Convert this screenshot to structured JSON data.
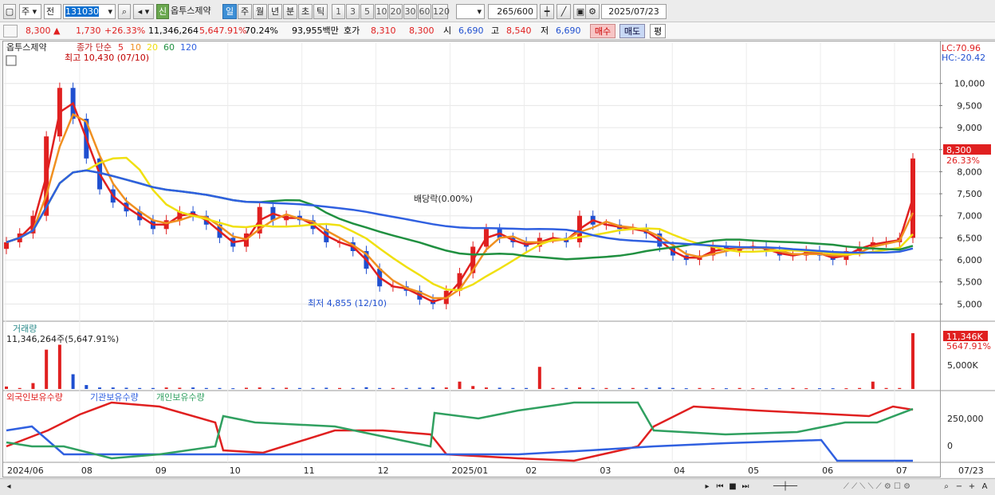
{
  "toolbar": {
    "type_label": "주",
    "prev_label": "전",
    "code_value": "131030",
    "new_badge": "신",
    "stock_name": "옵투스제약",
    "periods": [
      "일",
      "주",
      "월",
      "년",
      "분",
      "초",
      "틱"
    ],
    "active_period": "일",
    "intervals": [
      "1",
      "3",
      "5",
      "10",
      "20",
      "30",
      "60",
      "120"
    ],
    "count_value": "265",
    "count_max": "/600",
    "date_value": "2025/07/23"
  },
  "quote": {
    "price": "8,300",
    "arrow": "▲",
    "change": "1,730",
    "change_pct": "+26.33%",
    "volume": "11,346,264",
    "volume_pct": "5,647.91%",
    "turnover_pct": "70.24%",
    "amount": "93,955백만",
    "bid_label": "호가",
    "bid_value": "8,310",
    "ask_value": "8,300",
    "open_label": "시",
    "open_value": "6,690",
    "high_label": "고",
    "high_value": "8,540",
    "low_label": "저",
    "low_value": "6,690",
    "buy_label": "매수",
    "sell_label": "매도",
    "eval_label": "평"
  },
  "legend": {
    "stock_name": "옵투스제약",
    "ma_label": "종가 단순",
    "ma_periods": [
      "5",
      "10",
      "20",
      "60",
      "120"
    ],
    "ma_colors": [
      "#e02020",
      "#f09020",
      "#f0e010",
      "#209040",
      "#3060e0"
    ]
  },
  "annotations": {
    "high_label": "최고 10,430 (07/10)",
    "low_label": "최저 4,855 (12/10)",
    "dividend_label": "배당락(0.00%)",
    "lc_label": "LC:70.96",
    "hc_label": "HC:-20.42",
    "current_price_badge": "8,300",
    "current_pct": "26.33%"
  },
  "volume_panel": {
    "title": "거래량",
    "value_text": "11,346,264주(5,647.91%)",
    "badge": "11,346K",
    "badge_pct": "5647.91%"
  },
  "holdings_panel": {
    "labels": [
      "외국인보유수량",
      "기관보유수량",
      "개인보유수량"
    ],
    "colors": [
      "#e02020",
      "#3060e0",
      "#30a060"
    ]
  },
  "chart_data": {
    "type": "candlestick",
    "price_ticks": [
      "10,000",
      "9,500",
      "9,000",
      "8,500",
      "8,000",
      "7,500",
      "7,000",
      "6,500",
      "6,000",
      "5,500",
      "5,000"
    ],
    "volume_ticks": [
      "5,000K"
    ],
    "holding_ticks": [
      "250,000",
      "0"
    ],
    "x_labels": [
      "2024/06",
      "08",
      "09",
      "10",
      "11",
      "12",
      "2025/01",
      "02",
      "03",
      "04",
      "05",
      "06",
      "07",
      "07/23"
    ],
    "price_range": [
      4700,
      10700
    ],
    "closes": [
      6400,
      6600,
      7000,
      8800,
      9900,
      9200,
      8300,
      7600,
      7300,
      7100,
      6900,
      6700,
      6900,
      7100,
      7000,
      6800,
      6500,
      6300,
      6600,
      7200,
      6900,
      7000,
      6900,
      6700,
      6400,
      6400,
      6200,
      5800,
      5400,
      5400,
      5300,
      5100,
      5000,
      5300,
      5700,
      6300,
      6700,
      6500,
      6400,
      6300,
      6500,
      6500,
      6400,
      7000,
      6800,
      6800,
      6700,
      6700,
      6600,
      6300,
      6100,
      6000,
      6100,
      6300,
      6200,
      6300,
      6300,
      6200,
      6100,
      6100,
      6200,
      6100,
      6000,
      6200,
      6300,
      6400,
      6400,
      6500,
      8300
    ],
    "volume_units": "K",
    "volume_bars": [
      500,
      200,
      1200,
      8000,
      9000,
      3000,
      800,
      300,
      300,
      250,
      200,
      200,
      300,
      250,
      300,
      200,
      200,
      150,
      250,
      300,
      200,
      250,
      200,
      200,
      250,
      200,
      200,
      350,
      200,
      200,
      200,
      250,
      300,
      300,
      1500,
      600,
      300,
      250,
      200,
      200,
      4500,
      200,
      200,
      300,
      200,
      200,
      200,
      200,
      200,
      300,
      200,
      150,
      200,
      150,
      150,
      200,
      150,
      150,
      150,
      200,
      150,
      150,
      150,
      150,
      200,
      1500,
      200,
      200,
      11346
    ],
    "series": [
      {
        "name": "외국인보유수량"
      },
      {
        "name": "기관보유수량"
      },
      {
        "name": "개인보유수량"
      }
    ]
  }
}
